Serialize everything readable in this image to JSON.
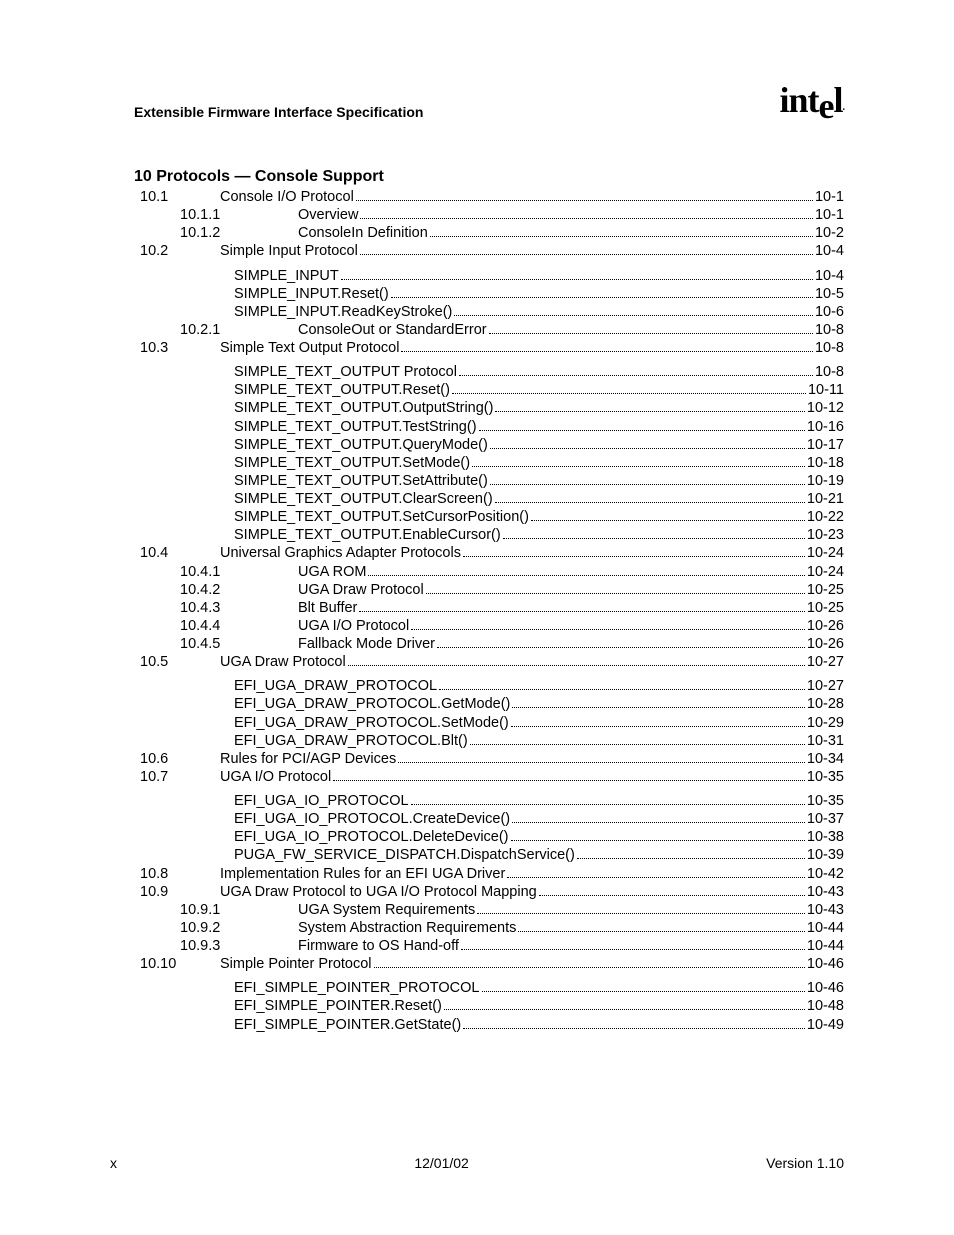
{
  "header": {
    "doc_title": "Extensible Firmware Interface Specification",
    "logo_text": "intel"
  },
  "section_title": "10 Protocols — Console Support",
  "toc": [
    {
      "indent": 0,
      "num": "10.1",
      "label": "Console I/O Protocol",
      "page": "10-1"
    },
    {
      "indent": 1,
      "num": "10.1.1",
      "label": "Overview",
      "page": "10-1"
    },
    {
      "indent": 1,
      "num": "10.1.2",
      "label": "ConsoleIn Definition",
      "page": "10-2"
    },
    {
      "indent": 0,
      "num": "10.2",
      "label": "Simple Input Protocol",
      "page": "10-4"
    },
    {
      "gap": true
    },
    {
      "indent": 2,
      "num": "",
      "label": "SIMPLE_INPUT",
      "page": "10-4"
    },
    {
      "indent": 2,
      "num": "",
      "label": "SIMPLE_INPUT.Reset()",
      "page": "10-5"
    },
    {
      "indent": 2,
      "num": "",
      "label": "SIMPLE_INPUT.ReadKeyStroke()",
      "page": "10-6"
    },
    {
      "indent": 1,
      "num": "10.2.1",
      "label": "ConsoleOut or StandardError",
      "page": "10-8"
    },
    {
      "indent": 0,
      "num": "10.3",
      "label": "Simple Text Output Protocol",
      "page": "10-8"
    },
    {
      "gap": true
    },
    {
      "indent": 2,
      "num": "",
      "label": "SIMPLE_TEXT_OUTPUT Protocol",
      "page": "10-8"
    },
    {
      "indent": 2,
      "num": "",
      "label": "SIMPLE_TEXT_OUTPUT.Reset()",
      "page": "10-11"
    },
    {
      "indent": 2,
      "num": "",
      "label": "SIMPLE_TEXT_OUTPUT.OutputString()",
      "page": "10-12"
    },
    {
      "indent": 2,
      "num": "",
      "label": "SIMPLE_TEXT_OUTPUT.TestString()",
      "page": "10-16"
    },
    {
      "indent": 2,
      "num": "",
      "label": "SIMPLE_TEXT_OUTPUT.QueryMode()",
      "page": "10-17"
    },
    {
      "indent": 2,
      "num": "",
      "label": "SIMPLE_TEXT_OUTPUT.SetMode()",
      "page": "10-18"
    },
    {
      "indent": 2,
      "num": "",
      "label": "SIMPLE_TEXT_OUTPUT.SetAttribute()",
      "page": "10-19"
    },
    {
      "indent": 2,
      "num": "",
      "label": "SIMPLE_TEXT_OUTPUT.ClearScreen()",
      "page": "10-21"
    },
    {
      "indent": 2,
      "num": "",
      "label": "SIMPLE_TEXT_OUTPUT.SetCursorPosition()",
      "page": "10-22"
    },
    {
      "indent": 2,
      "num": "",
      "label": "SIMPLE_TEXT_OUTPUT.EnableCursor()",
      "page": "10-23"
    },
    {
      "indent": 0,
      "num": "10.4",
      "label": "Universal Graphics Adapter Protocols",
      "page": "10-24"
    },
    {
      "indent": 1,
      "num": "10.4.1",
      "label": "UGA ROM",
      "page": "10-24"
    },
    {
      "indent": 1,
      "num": "10.4.2",
      "label": "UGA Draw Protocol",
      "page": "10-25"
    },
    {
      "indent": 1,
      "num": "10.4.3",
      "label": "Blt Buffer",
      "page": "10-25"
    },
    {
      "indent": 1,
      "num": "10.4.4",
      "label": "UGA I/O Protocol",
      "page": "10-26"
    },
    {
      "indent": 1,
      "num": "10.4.5",
      "label": "Fallback Mode Driver",
      "page": "10-26"
    },
    {
      "indent": 0,
      "num": "10.5",
      "label": "UGA Draw Protocol",
      "page": "10-27"
    },
    {
      "gap": true
    },
    {
      "indent": 2,
      "num": "",
      "label": "EFI_UGA_DRAW_PROTOCOL",
      "page": "10-27"
    },
    {
      "indent": 2,
      "num": "",
      "label": "EFI_UGA_DRAW_PROTOCOL.GetMode()",
      "page": "10-28"
    },
    {
      "indent": 2,
      "num": "",
      "label": "EFI_UGA_DRAW_PROTOCOL.SetMode()",
      "page": "10-29"
    },
    {
      "indent": 2,
      "num": "",
      "label": "EFI_UGA_DRAW_PROTOCOL.Blt()",
      "page": "10-31"
    },
    {
      "indent": 0,
      "num": "10.6",
      "label": "Rules for PCI/AGP Devices",
      "page": "10-34"
    },
    {
      "indent": 0,
      "num": "10.7",
      "label": "UGA I/O Protocol",
      "page": "10-35"
    },
    {
      "gap": true
    },
    {
      "indent": 2,
      "num": "",
      "label": "EFI_UGA_IO_PROTOCOL",
      "page": "10-35"
    },
    {
      "indent": 2,
      "num": "",
      "label": "EFI_UGA_IO_PROTOCOL.CreateDevice()",
      "page": "10-37"
    },
    {
      "indent": 2,
      "num": "",
      "label": "EFI_UGA_IO_PROTOCOL.DeleteDevice()",
      "page": "10-38"
    },
    {
      "indent": 2,
      "num": "",
      "label": "PUGA_FW_SERVICE_DISPATCH.DispatchService()",
      "page": "10-39"
    },
    {
      "indent": 0,
      "num": "10.8",
      "label": "Implementation Rules for an EFI UGA Driver",
      "page": "10-42"
    },
    {
      "indent": 0,
      "num": "10.9",
      "label": "UGA Draw Protocol to UGA I/O Protocol Mapping",
      "page": "10-43"
    },
    {
      "indent": 1,
      "num": "10.9.1",
      "label": "UGA System Requirements",
      "page": "10-43"
    },
    {
      "indent": 1,
      "num": "10.9.2",
      "label": "System Abstraction Requirements",
      "page": "10-44"
    },
    {
      "indent": 1,
      "num": "10.9.3",
      "label": "Firmware to OS Hand-off",
      "page": "10-44"
    },
    {
      "indent": 0,
      "num": "10.10",
      "label": "Simple Pointer Protocol",
      "page": "10-46"
    },
    {
      "gap": true
    },
    {
      "indent": 2,
      "num": "",
      "label": "EFI_SIMPLE_POINTER_PROTOCOL",
      "page": "10-46"
    },
    {
      "indent": 2,
      "num": "",
      "label": "EFI_SIMPLE_POINTER.Reset()",
      "page": "10-48"
    },
    {
      "indent": 2,
      "num": "",
      "label": "EFI_SIMPLE_POINTER.GetState()",
      "page": "10-49"
    }
  ],
  "footer": {
    "left": "x",
    "center": "12/01/02",
    "right": "Version 1.10"
  }
}
